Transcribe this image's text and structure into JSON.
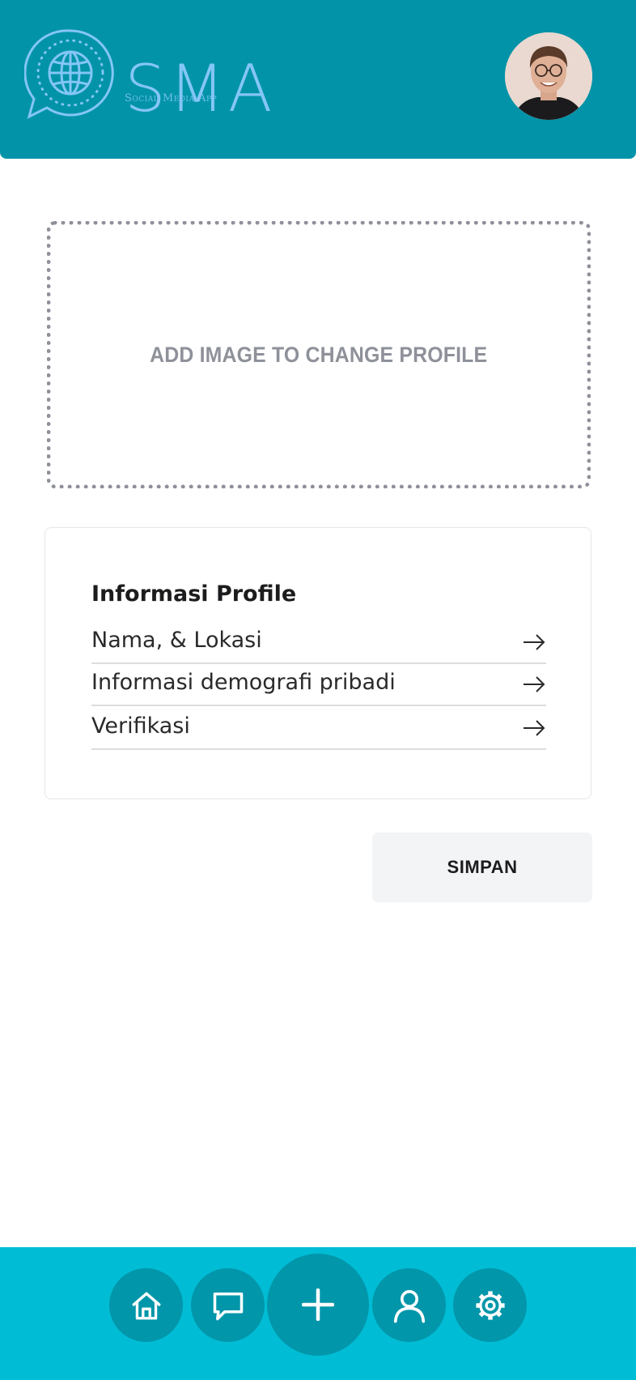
{
  "header": {
    "logo_title": "SMA",
    "logo_subtitle": "Social Media App",
    "logo_icon": "globe-chat-icon",
    "avatar": "user-avatar"
  },
  "upload": {
    "label": "ADD IMAGE TO CHANGE PROFILE"
  },
  "profile_card": {
    "title": "Informasi Profile",
    "items": [
      {
        "label": "Nama, & Lokasi",
        "icon": "arrow-right-icon"
      },
      {
        "label": "Informasi demografi pribadi",
        "icon": "arrow-right-icon"
      },
      {
        "label": "Verifikasi",
        "icon": "arrow-right-icon"
      }
    ]
  },
  "actions": {
    "save_label": "SIMPAN"
  },
  "bottom_nav": {
    "items": [
      {
        "icon": "home-icon"
      },
      {
        "icon": "chat-icon"
      },
      {
        "icon": "plus-icon"
      },
      {
        "icon": "user-icon"
      },
      {
        "icon": "gear-icon"
      }
    ]
  },
  "colors": {
    "header_bg": "#0293a8",
    "logo": "#84c6f5",
    "bottom_bar": "#01bcd5",
    "nav_button": "#0296aa",
    "dropzone_border": "#8e9199",
    "save_button_bg": "#f3f4f6"
  }
}
